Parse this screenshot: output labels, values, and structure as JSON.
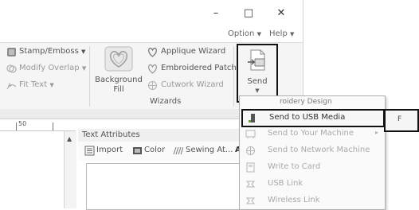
{
  "window": {
    "minimize": "–",
    "maximize": "□",
    "close": "✕"
  },
  "menubar": {
    "option": "Option",
    "help": "Help"
  },
  "ribbon": {
    "stamp_emboss": "Stamp/Emboss",
    "modify_overlap": "Modify Overlap",
    "fit_text": "Fit Text",
    "background_fill_line1": "Background",
    "background_fill_line2": "Fill",
    "applique_wizard": "Applique Wizard",
    "embroidered_patch": "Embroidered Patch",
    "cutwork_wizard": "Cutwork Wizard",
    "wizards_group": "Wizards",
    "send": "Send"
  },
  "ruler": {
    "mark": "50"
  },
  "text_attributes": {
    "title": "Text Attributes",
    "import": "Import",
    "color": "Color",
    "sewing_attributes": "Sewing At...",
    "extra": "Al"
  },
  "send_menu": {
    "partial_header": "roidery Design",
    "shortcut": "F",
    "items": [
      {
        "label": "Send to USB Media",
        "enabled": true,
        "highlighted": true
      },
      {
        "label": "Send to Your Machine",
        "enabled": false,
        "has_submenu": true
      },
      {
        "label": "Send to Network Machine",
        "enabled": false
      },
      {
        "label": "Write to Card",
        "enabled": false
      },
      {
        "label": "USB Link",
        "enabled": false
      },
      {
        "label": "Wireless Link",
        "enabled": false
      }
    ]
  },
  "colors": {
    "highlight_border": "#111111",
    "disabled_text": "#a9a9a9",
    "accent_icon": "#6a9a3a"
  }
}
